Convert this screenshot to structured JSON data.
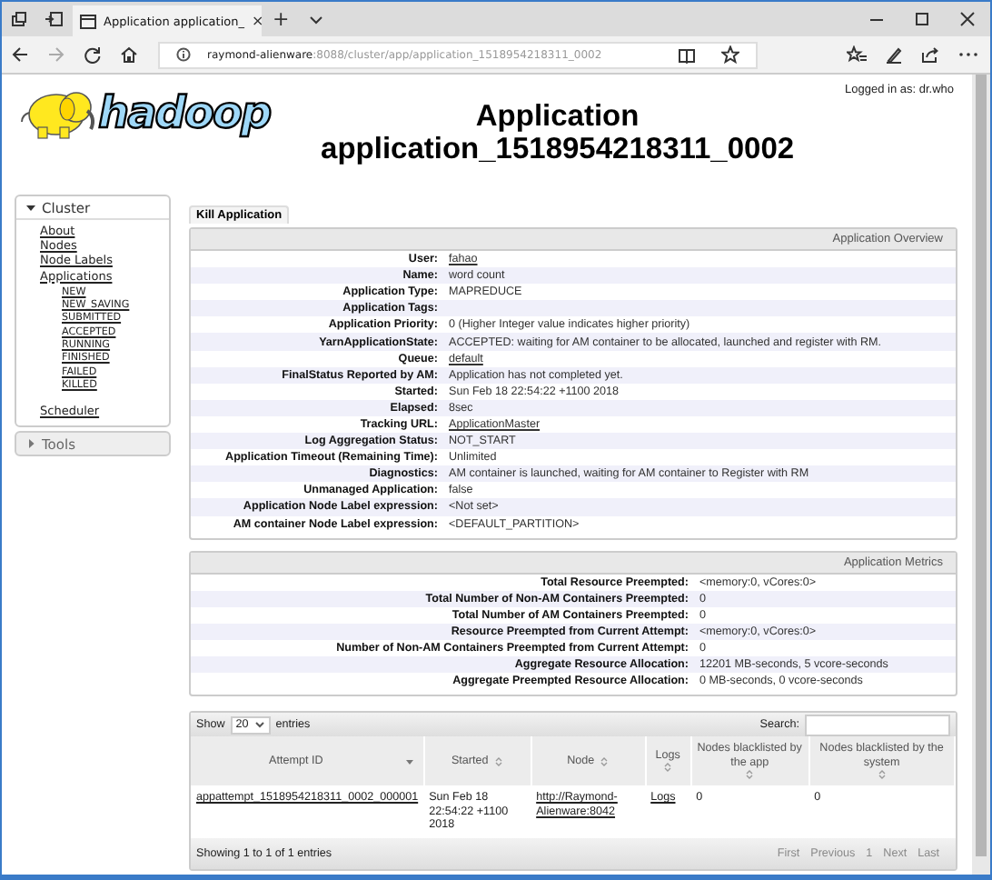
{
  "browser": {
    "tab_title": "Application application_",
    "tab_close": "×",
    "new_tab": "+",
    "url_host": "raymond-alienware",
    "url_path": ":8088/cluster/app/application_1518954218311_0002"
  },
  "header": {
    "logo_text": "hadoop",
    "logged_in": "Logged in as: dr.who",
    "title_line1": "Application",
    "title_line2": "application_1518954218311_0002"
  },
  "sidebar": {
    "sections": [
      {
        "label": "Cluster",
        "expanded": true,
        "items": [
          {
            "label": "About"
          },
          {
            "label": "Nodes"
          },
          {
            "label": "Node Labels"
          },
          {
            "label": "Applications",
            "children": [
              {
                "label": "NEW"
              },
              {
                "label": "NEW_SAVING"
              },
              {
                "label": "SUBMITTED"
              },
              {
                "label": "ACCEPTED"
              },
              {
                "label": "RUNNING"
              },
              {
                "label": "FINISHED"
              },
              {
                "label": "FAILED"
              },
              {
                "label": "KILLED"
              }
            ]
          },
          {
            "label": "Scheduler"
          }
        ]
      },
      {
        "label": "Tools",
        "expanded": false
      }
    ]
  },
  "kill_button": "Kill Application",
  "overview": {
    "title": "Application Overview",
    "rows": [
      {
        "label": "User:",
        "value": "fahao",
        "kind": "link"
      },
      {
        "label": "Name:",
        "value": "word count",
        "kind": "text"
      },
      {
        "label": "Application Type:",
        "value": "MAPREDUCE",
        "kind": "text"
      },
      {
        "label": "Application Tags:"
      },
      {
        "label": "Application Priority:",
        "value": "0 (Higher Integer value indicates higher priority)",
        "kind": "text"
      },
      {
        "label": "YarnApplicationState:",
        "value": "ACCEPTED: waiting for AM container to be allocated, launched and register with RM.",
        "kind": "text"
      },
      {
        "label": "Queue:",
        "value": "default",
        "kind": "link"
      },
      {
        "label": "FinalStatus Reported by AM:",
        "value": "Application has not completed yet.",
        "kind": "text"
      },
      {
        "label": "Started:",
        "value": "Sun Feb 18 22:54:22 +1100 2018",
        "kind": "text"
      },
      {
        "label": "Elapsed:",
        "value": "8sec",
        "kind": "text"
      },
      {
        "label": "Tracking URL:",
        "value": "ApplicationMaster",
        "kind": "link"
      },
      {
        "label": "Log Aggregation Status:",
        "value": "NOT_START",
        "kind": "text"
      },
      {
        "label": "Application Timeout (Remaining Time):",
        "value": "Unlimited",
        "kind": "text"
      },
      {
        "label": "Diagnostics:",
        "value": "AM container is launched, waiting for AM container to Register with RM",
        "kind": "text"
      },
      {
        "label": "Unmanaged Application:",
        "value": "false",
        "kind": "text"
      },
      {
        "label": "Application Node Label expression:",
        "value": "<Not set>",
        "kind": "text"
      },
      {
        "label": "AM container Node Label expression:",
        "value": "<DEFAULT_PARTITION>",
        "kind": "text"
      }
    ]
  },
  "metrics": {
    "title": "Application Metrics",
    "rows": [
      {
        "label": "Total Resource Preempted:",
        "value": "<memory:0, vCores:0>"
      },
      {
        "label": "Total Number of Non-AM Containers Preempted:",
        "value": "0"
      },
      {
        "label": "Total Number of AM Containers Preempted:",
        "value": "0"
      },
      {
        "label": "Resource Preempted from Current Attempt:",
        "value": "<memory:0, vCores:0>"
      },
      {
        "label": "Number of Non-AM Containers Preempted from Current Attempt:",
        "value": "0"
      },
      {
        "label": "Aggregate Resource Allocation:",
        "value": "12201 MB-seconds, 5 vcore-seconds"
      },
      {
        "label": "Aggregate Preempted Resource Allocation:",
        "value": "0 MB-seconds, 0 vcore-seconds"
      }
    ]
  },
  "attempts": {
    "show_label": "Show",
    "page_size": "20",
    "entries_label": "entries",
    "search_label": "Search:",
    "columns": [
      {
        "label": "Attempt ID",
        "sorted": true
      },
      {
        "label": "Started",
        "sorted": false
      },
      {
        "label": "Node",
        "sorted": false
      },
      {
        "label": "Logs",
        "sorted": false
      },
      {
        "label": "Nodes blacklisted by the app",
        "sorted": false
      },
      {
        "label": "Nodes blacklisted by the system",
        "sorted": false
      }
    ],
    "rows": [
      [
        {
          "value": "appattempt_1518954218311_0002_000001",
          "kind": "link"
        },
        {
          "value": "Sun Feb 18 22:54:22 +1100 2018",
          "kind": "text"
        },
        {
          "value": "http://Raymond-Alienware:8042",
          "kind": "link"
        },
        {
          "value": "Logs",
          "kind": "link"
        },
        {
          "value": "0",
          "kind": "text"
        },
        {
          "value": "0",
          "kind": "text"
        }
      ]
    ],
    "info": "Showing 1 to 1 of 1 entries",
    "paging": [
      {
        "label": "First",
        "disabled": true
      },
      {
        "label": "Previous",
        "disabled": true
      },
      {
        "label": "1",
        "disabled": true
      },
      {
        "label": "Next",
        "disabled": true
      },
      {
        "label": "Last",
        "disabled": true
      }
    ]
  }
}
